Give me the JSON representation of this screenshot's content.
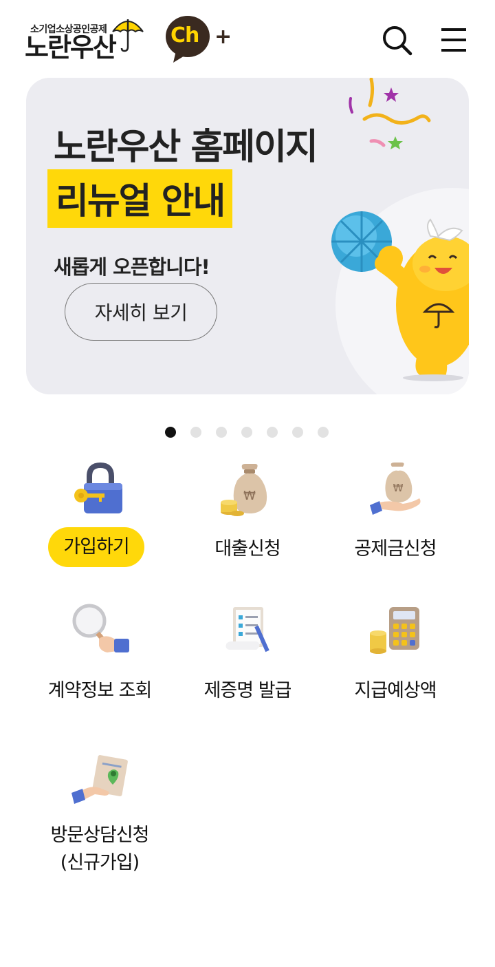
{
  "header": {
    "logo_sub": "소기업소상공인공제",
    "logo_main": "노란우산",
    "channel_text": "Ch",
    "channel_plus": "+",
    "search_icon": "search-icon",
    "menu_icon": "hamburger-menu-icon"
  },
  "banner": {
    "title_line1": "노란우산 홈페이지",
    "title_line2": "리뉴얼 안내",
    "subtitle": "새롭게 오픈합니다!",
    "button_label": "자세히 보기",
    "highlight_color": "#ffd80a",
    "background_color": "#ececf1"
  },
  "carousel": {
    "total": 7,
    "active_index": 0
  },
  "menu": [
    {
      "label": "가입하기",
      "icon": "padlock-key-icon",
      "highlighted": true
    },
    {
      "label": "대출신청",
      "icon": "money-bag-coins-icon"
    },
    {
      "label": "공제금신청",
      "icon": "money-bag-hand-icon"
    },
    {
      "label": "계약정보 조회",
      "icon": "magnifier-hand-icon"
    },
    {
      "label": "제증명 발급",
      "icon": "checklist-document-icon"
    },
    {
      "label": "지급예상액",
      "icon": "calculator-coins-icon"
    },
    {
      "label_line1": "방문상담신청",
      "label_line2": "(신규가입)",
      "icon": "location-document-hand-icon"
    }
  ],
  "colors": {
    "brand_yellow": "#ffd80a",
    "channel_brown": "#3a2a20"
  }
}
